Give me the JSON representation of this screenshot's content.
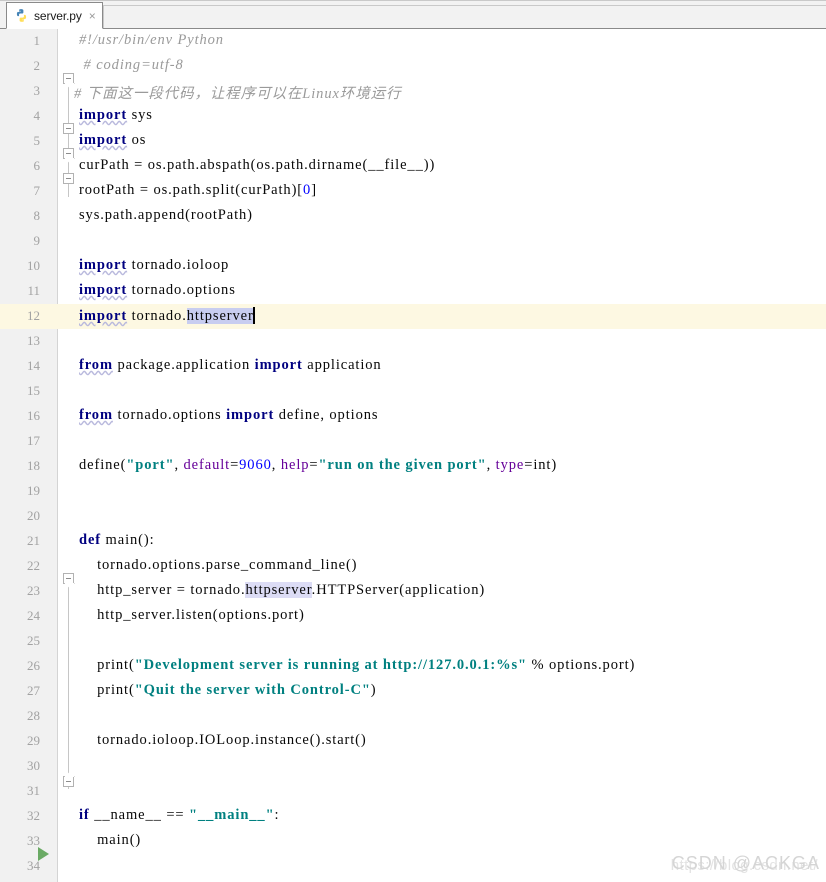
{
  "tab": {
    "filename": "server.py",
    "icon": "python-file-icon",
    "close": "×"
  },
  "editor": {
    "current_line": 12,
    "run_marker_line": 32,
    "caret_line": 12,
    "colors": {
      "keyword": "#000080",
      "comment": "#9a9a9a",
      "string": "#008080",
      "number": "#0000ff",
      "kwarg": "#660099",
      "selection": "#c8cdf0",
      "occurrence": "#dcdcf5",
      "current_line_bg": "#fdf8e2",
      "gutter_bg": "#f1f1f1",
      "run_arrow": "#6aaa64"
    },
    "line_numbers": [
      1,
      2,
      3,
      4,
      5,
      6,
      7,
      8,
      9,
      10,
      11,
      12,
      13,
      14,
      15,
      16,
      17,
      18,
      19,
      20,
      21,
      22,
      23,
      24,
      25,
      26,
      27,
      28,
      29,
      30,
      31,
      32,
      33,
      34
    ],
    "lines": [
      {
        "n": 1,
        "fold": "tip",
        "text": "#!/usr/bin/env Python"
      },
      {
        "n": 2,
        "fold": null,
        "text": " # coding=utf-8"
      },
      {
        "n": 3,
        "fold": "plain",
        "text": "# 下面这一段代码，让程序可以在Linux环境运行"
      },
      {
        "n": 4,
        "fold": "tip",
        "text": "import sys"
      },
      {
        "n": 5,
        "fold": "plain",
        "text": "import os"
      },
      {
        "n": 6,
        "fold": null,
        "text": "curPath = os.path.abspath(os.path.dirname(__file__))"
      },
      {
        "n": 7,
        "fold": null,
        "text": "rootPath = os.path.split(curPath)[0]"
      },
      {
        "n": 8,
        "fold": null,
        "text": "sys.path.append(rootPath)"
      },
      {
        "n": 9,
        "fold": null,
        "text": ""
      },
      {
        "n": 10,
        "fold": null,
        "text": "import tornado.ioloop"
      },
      {
        "n": 11,
        "fold": null,
        "text": "import tornado.options"
      },
      {
        "n": 12,
        "fold": null,
        "text": "import tornado.httpserver"
      },
      {
        "n": 13,
        "fold": null,
        "text": ""
      },
      {
        "n": 14,
        "fold": null,
        "text": "from package.application import application"
      },
      {
        "n": 15,
        "fold": null,
        "text": ""
      },
      {
        "n": 16,
        "fold": null,
        "text": "from tornado.options import define, options"
      },
      {
        "n": 17,
        "fold": null,
        "text": ""
      },
      {
        "n": 18,
        "fold": null,
        "text": "define(\"port\", default=9060, help=\"run on the given port\", type=int)"
      },
      {
        "n": 19,
        "fold": null,
        "text": ""
      },
      {
        "n": 20,
        "fold": null,
        "text": ""
      },
      {
        "n": 21,
        "fold": "tip",
        "text": "def main():"
      },
      {
        "n": 22,
        "fold": null,
        "text": "    tornado.options.parse_command_line()"
      },
      {
        "n": 23,
        "fold": null,
        "text": "    http_server = tornado.httpserver.HTTPServer(application)"
      },
      {
        "n": 24,
        "fold": null,
        "text": "    http_server.listen(options.port)"
      },
      {
        "n": 25,
        "fold": null,
        "text": ""
      },
      {
        "n": 26,
        "fold": null,
        "text": "    print(\"Development server is running at http://127.0.0.1:%s\" % options.port)"
      },
      {
        "n": 27,
        "fold": null,
        "text": "    print(\"Quit the server with Control-C\")"
      },
      {
        "n": 28,
        "fold": null,
        "text": ""
      },
      {
        "n": 29,
        "fold": "tipup",
        "text": "    tornado.ioloop.IOLoop.instance().start()"
      },
      {
        "n": 30,
        "fold": null,
        "text": ""
      },
      {
        "n": 31,
        "fold": null,
        "text": ""
      },
      {
        "n": 32,
        "fold": null,
        "text": "if __name__ == \"__main__\":"
      },
      {
        "n": 33,
        "fold": null,
        "text": "    main()"
      },
      {
        "n": 34,
        "fold": null,
        "text": ""
      }
    ]
  },
  "watermark": {
    "url": "https://blog.csdn.net/",
    "brand": "CSDN @ACKGA"
  }
}
